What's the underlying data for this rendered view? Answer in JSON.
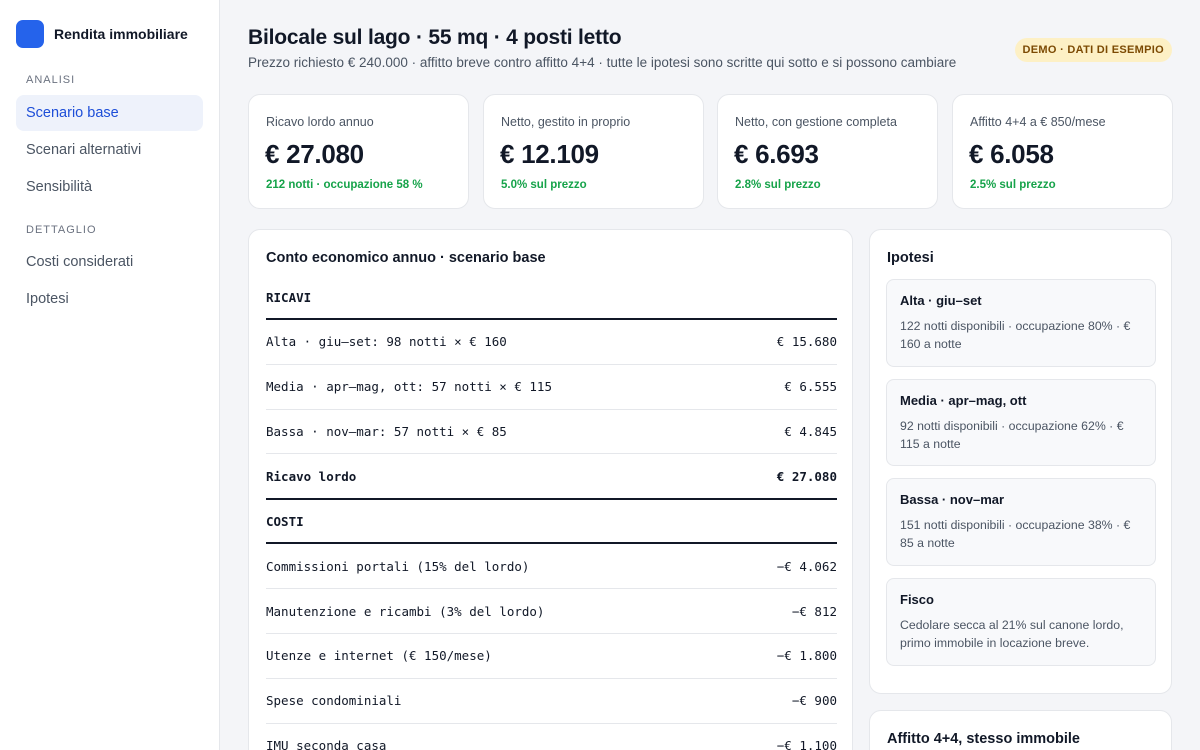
{
  "app": {
    "name": "Rendita immobiliare"
  },
  "sidebar": {
    "section_analysis": "ANALISI",
    "section_detail": "DETTAGLIO",
    "items": [
      {
        "label": "Scenario base",
        "active": true
      },
      {
        "label": "Scenari alternativi"
      },
      {
        "label": "Sensibilità"
      },
      {
        "label": "Costi considerati"
      },
      {
        "label": "Ipotesi"
      }
    ]
  },
  "header": {
    "title": "Bilocale sul lago · 55 mq · 4 posti letto",
    "subtitle": "Prezzo richiesto € 240.000 · affitto breve contro affitto 4+4 · tutte le ipotesi sono scritte qui sotto e si possono cambiare",
    "badge": "DEMO · DATI DI ESEMPIO"
  },
  "kpis": [
    {
      "label": "Ricavo lordo annuo",
      "value": "€ 27.080",
      "note": "212 notti · occupazione 58 %"
    },
    {
      "label": "Netto, gestito in proprio",
      "value": "€ 12.109",
      "note": "5.0% sul prezzo"
    },
    {
      "label": "Netto, con gestione completa",
      "value": "€ 6.693",
      "note": "2.8% sul prezzo"
    },
    {
      "label": "Affitto 4+4 a € 850/mese",
      "value": "€ 6.058",
      "note": "2.5% sul prezzo"
    }
  ],
  "ledger": {
    "title": "Conto economico annuo · scenario base",
    "revenue_header": "RICAVI",
    "revenue_rows": [
      {
        "label": "Alta · giu–set: 98 notti × € 160",
        "amount": "€ 15.680"
      },
      {
        "label": "Media · apr–mag, ott: 57 notti × € 115",
        "amount": "€ 6.555"
      },
      {
        "label": "Bassa · nov–mar: 57 notti × € 85",
        "amount": "€ 4.845"
      }
    ],
    "revenue_total": {
      "label": "Ricavo lordo",
      "amount": "€ 27.080"
    },
    "cost_header": "COSTI",
    "cost_rows": [
      {
        "label": "Commissioni portali (15% del lordo)",
        "amount": "−€ 4.062"
      },
      {
        "label": "Manutenzione e ricambi (3% del lordo)",
        "amount": "−€ 812"
      },
      {
        "label": "Utenze e internet (€ 150/mese)",
        "amount": "−€ 1.800"
      },
      {
        "label": "Spese condominiali",
        "amount": "−€ 900"
      },
      {
        "label": "IMU seconda casa",
        "amount": "−€ 1.100"
      }
    ]
  },
  "hypotheses": {
    "title": "Ipotesi",
    "items": [
      {
        "title": "Alta · giu–set",
        "text": "122 notti disponibili · occupazione 80% · € 160 a notte"
      },
      {
        "title": "Media · apr–mag, ott",
        "text": "92 notti disponibili · occupazione 62% · € 115 a notte"
      },
      {
        "title": "Bassa · nov–mar",
        "text": "151 notti disponibili · occupazione 38% · € 85 a notte"
      },
      {
        "title": "Fisco",
        "text": "Cedolare secca al 21% sul canone lordo, primo immobile in locazione breve."
      }
    ]
  },
  "rental_card": {
    "title": "Affitto 4+4, stesso immobile"
  }
}
